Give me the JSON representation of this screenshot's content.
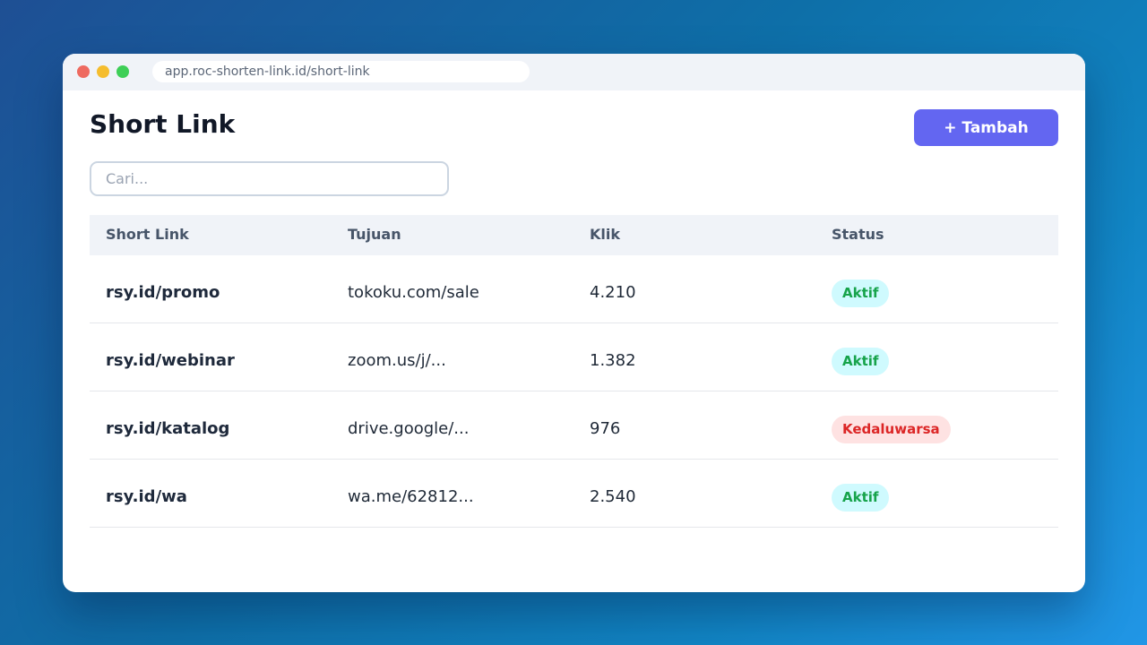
{
  "browser": {
    "url": "app.roc-shorten-link.id/short-link"
  },
  "page": {
    "title": "Short Link",
    "add_button_label": "+ Tambah",
    "search_placeholder": "Cari..."
  },
  "table": {
    "columns": [
      "Short Link",
      "Tujuan",
      "Klik",
      "Status"
    ],
    "rows": [
      {
        "short_link": "rsy.id/promo",
        "destination": "tokoku.com/sale",
        "clicks": "4.210",
        "status": "Aktif",
        "status_type": "active"
      },
      {
        "short_link": "rsy.id/webinar",
        "destination": "zoom.us/j/...",
        "clicks": "1.382",
        "status": "Aktif",
        "status_type": "active"
      },
      {
        "short_link": "rsy.id/katalog",
        "destination": "drive.google/...",
        "clicks": "976",
        "status": "Kedaluwarsa",
        "status_type": "expired"
      },
      {
        "short_link": "rsy.id/wa",
        "destination": "wa.me/62812...",
        "clicks": "2.540",
        "status": "Aktif",
        "status_type": "active"
      }
    ]
  },
  "colors": {
    "accent": "#6366f1",
    "status_active_bg": "#cffafe",
    "status_active_text": "#16a34a",
    "status_expired_bg": "#fee2e2",
    "status_expired_text": "#dc2626"
  }
}
